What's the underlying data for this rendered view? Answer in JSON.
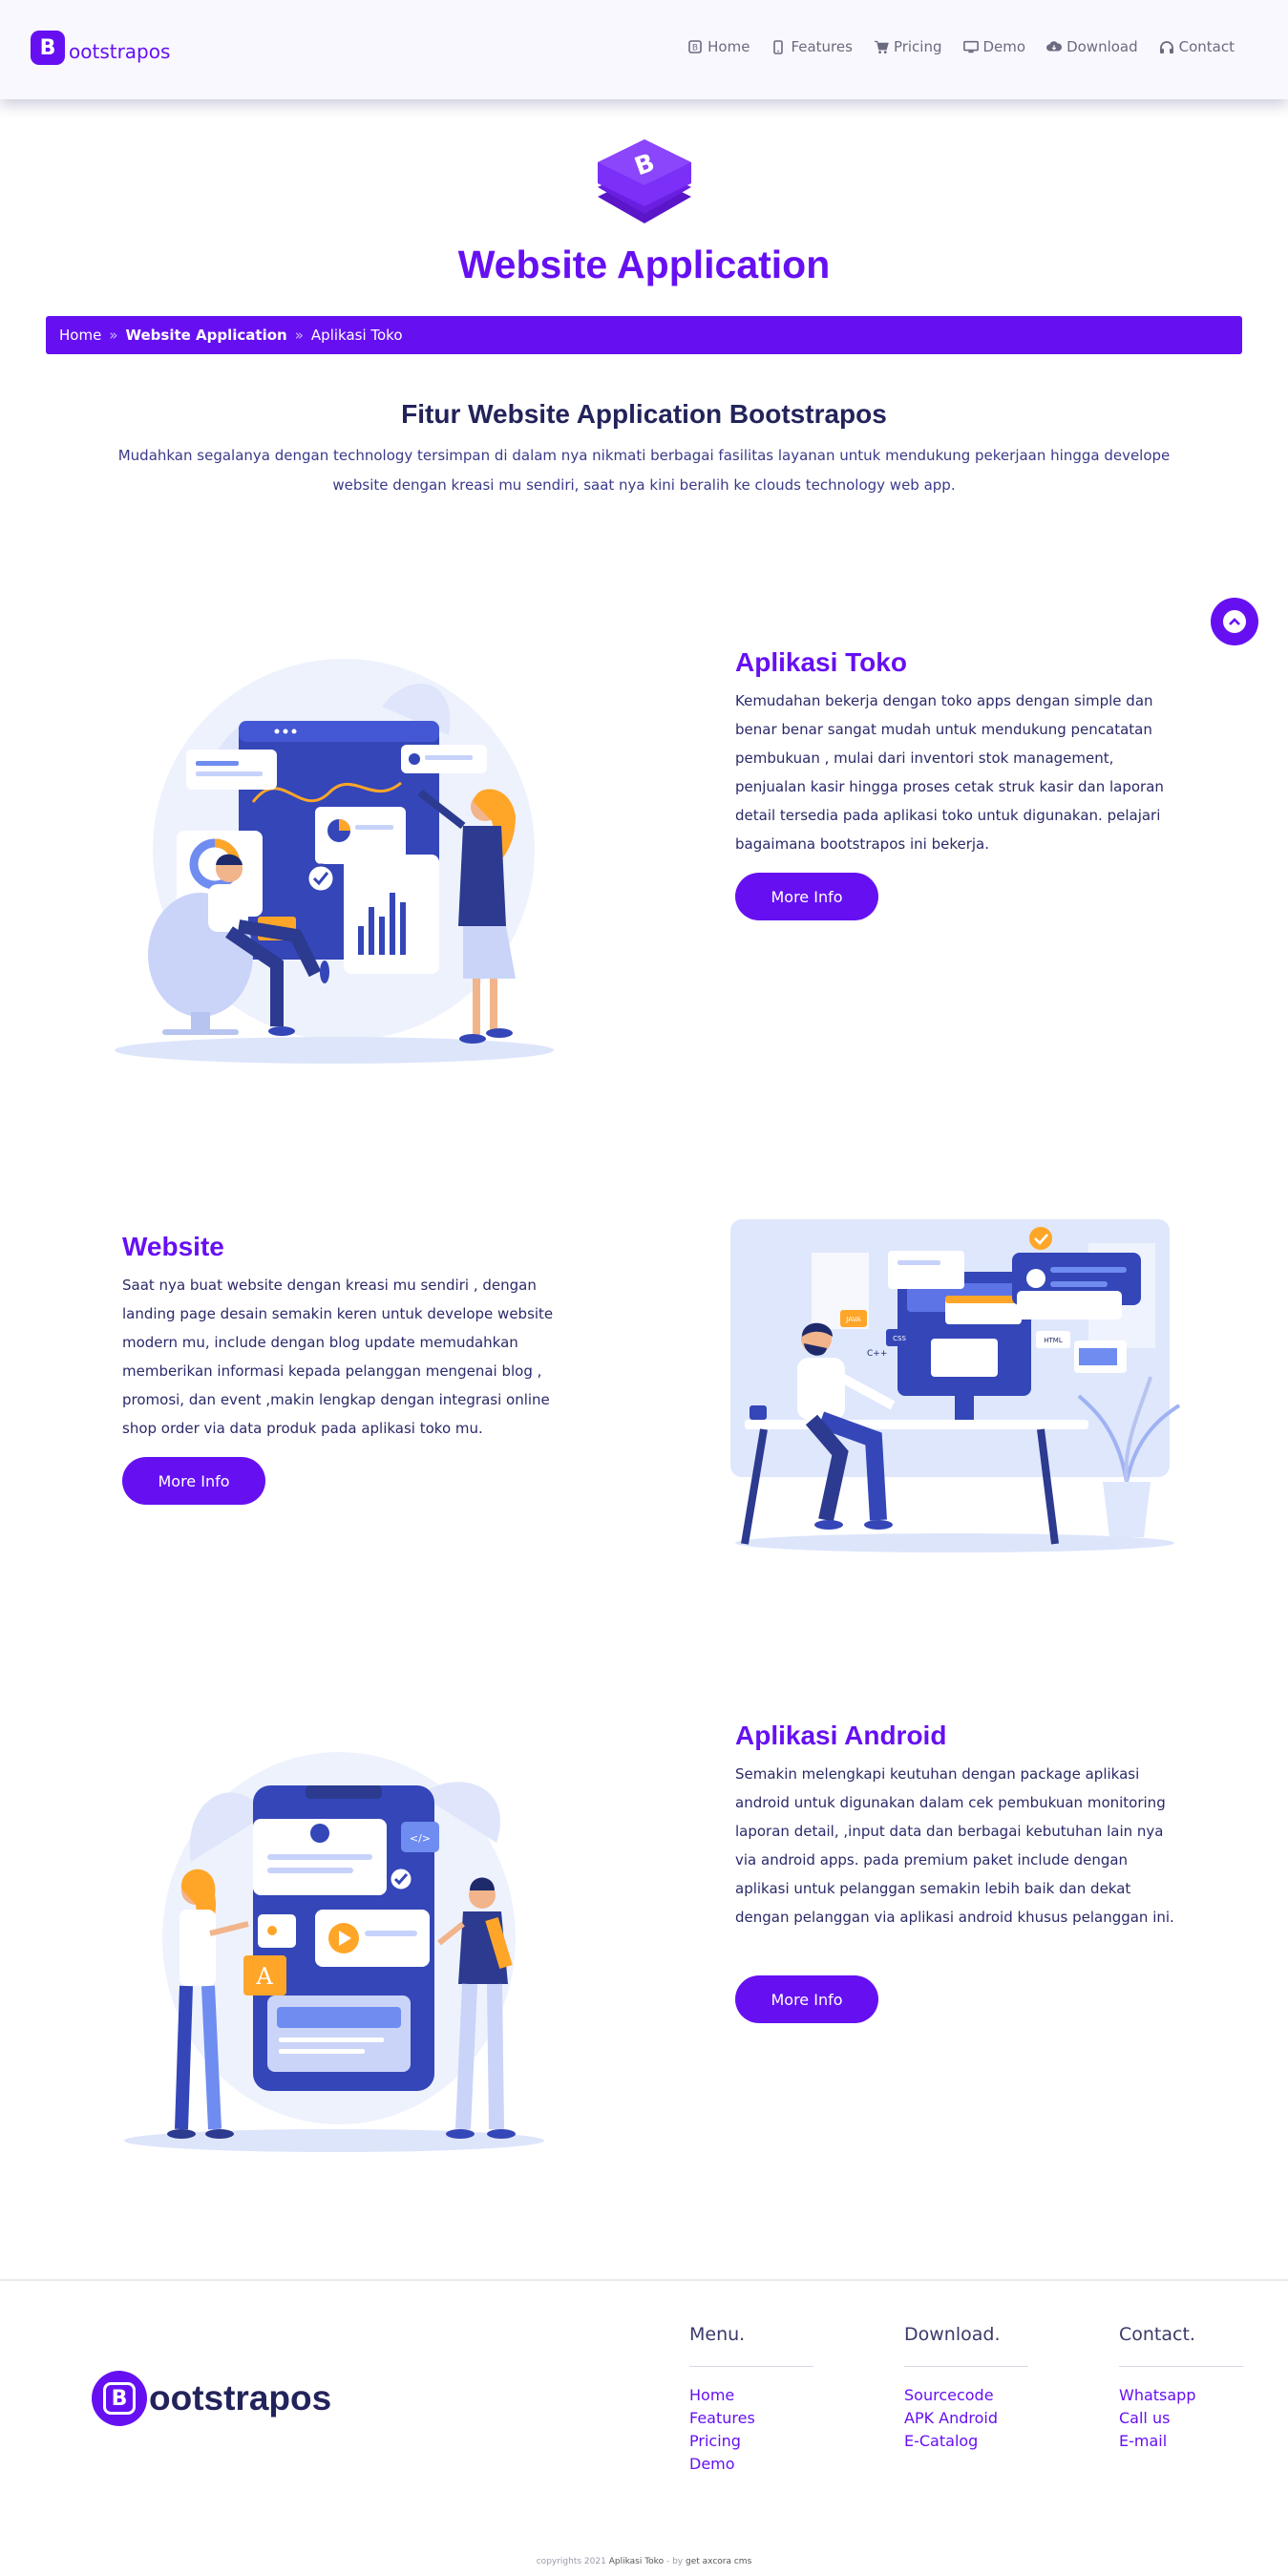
{
  "header": {
    "brand_letter": "B",
    "brand_text": "ootstrapos",
    "nav": [
      {
        "label": "Home",
        "icon": "bootstrap-icon"
      },
      {
        "label": "Features",
        "icon": "mobile-icon"
      },
      {
        "label": "Pricing",
        "icon": "cart-icon"
      },
      {
        "label": "Demo",
        "icon": "desktop-icon"
      },
      {
        "label": "Download",
        "icon": "cloud-download-icon"
      },
      {
        "label": "Contact",
        "icon": "headphones-icon"
      }
    ]
  },
  "hero": {
    "title": "Website Application",
    "breadcrumb": [
      "Home",
      "Website Application",
      "Aplikasi Toko"
    ],
    "breadcrumb_separator": "»"
  },
  "intro": {
    "title": "Fitur Website Application Bootstrapos",
    "description": "Mudahkan segalanya dengan technology tersimpan di dalam nya nikmati berbagai fasilitas layanan untuk mendukung pekerjaan hingga develope website dengan kreasi mu sendiri, saat nya kini beralih ke clouds technology web app."
  },
  "features": [
    {
      "title": "Aplikasi Toko",
      "text": "Kemudahan bekerja dengan toko apps dengan simple dan benar benar sangat mudah untuk mendukung pencatatan pembukuan , mulai dari inventori stok management, penjualan kasir hingga proses cetak struk kasir dan laporan detail tersedia pada aplikasi toko untuk digunakan. pelajari bagaimana bootstrapos ini bekerja.",
      "button": "More Info"
    },
    {
      "title": "Website",
      "text": "Saat nya buat website dengan kreasi mu sendiri , dengan landing page desain semakin keren untuk develope website modern mu, include dengan blog update memudahkan memberikan informasi kepada pelanggan mengenai blog , promosi, dan event ,makin lengkap dengan integrasi online shop order via data produk pada aplikasi toko mu.",
      "button": "More Info"
    },
    {
      "title": "Aplikasi Android",
      "text": "Semakin melengkapi keutuhan dengan package aplikasi android untuk digunakan dalam cek pembukuan monitoring laporan detail, ,input data dan berbagai kebutuhan lain nya via android apps. pada premium paket include dengan aplikasi untuk pelanggan semakin lebih baik dan dekat dengan pelanggan via aplikasi android khusus pelanggan ini.",
      "button": "More Info"
    }
  ],
  "footer": {
    "brand_letter": "B",
    "brand_text": "ootstrapos",
    "columns": [
      {
        "title": "Menu.",
        "links": [
          "Home",
          "Features",
          "Pricing",
          "Demo"
        ]
      },
      {
        "title": "Download.",
        "links": [
          "Sourcecode",
          "APK Android",
          "E-Catalog"
        ]
      },
      {
        "title": "Contact.",
        "links": [
          "Whatsapp",
          "Call us",
          "E-mail"
        ]
      }
    ],
    "copyright_prefix": "copyrights 2021",
    "copyright_app": "Aplikasi Toko",
    "copyright_by": "- by",
    "copyright_vendor": "get axcora cms"
  },
  "colors": {
    "accent": "#6610f2",
    "dark": "#23235b"
  }
}
